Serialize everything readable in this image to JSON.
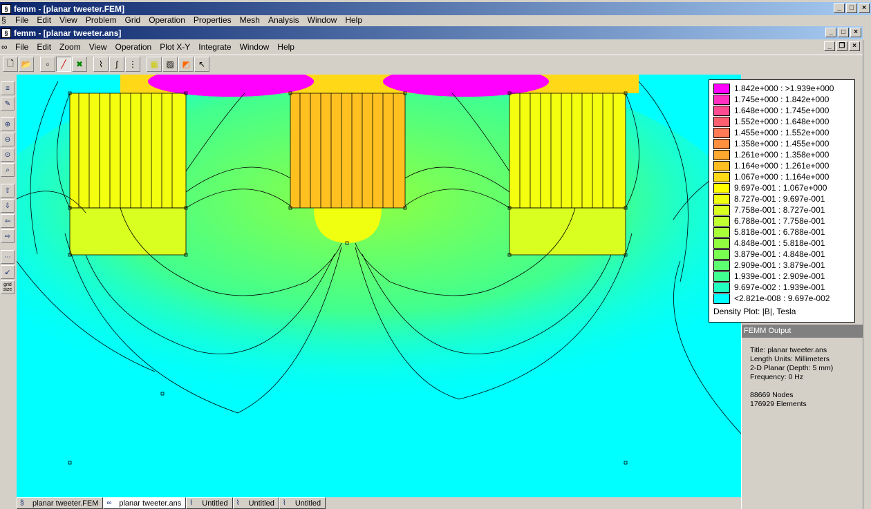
{
  "outer_window": {
    "title": "femm - [planar tweeter.FEM]",
    "menu": [
      "File",
      "Edit",
      "View",
      "Problem",
      "Grid",
      "Operation",
      "Properties",
      "Mesh",
      "Analysis",
      "Window",
      "Help"
    ]
  },
  "inner_window": {
    "title": "femm - [planar tweeter.ans]",
    "menu": [
      "File",
      "Edit",
      "Zoom",
      "View",
      "Operation",
      "Plot X-Y",
      "Integrate",
      "Window",
      "Help"
    ]
  },
  "toolbar": {
    "icons": [
      "new-icon",
      "open-icon",
      "point-mode-icon",
      "contour-mode-icon",
      "area-mode-icon",
      "plot-xy-icon",
      "integrate-icon",
      "block-integral-icon",
      "grid-icon",
      "hatch-icon",
      "density-icon",
      "arrow-icon"
    ]
  },
  "left_toolbar": {
    "icons": [
      "legend-toggle-icon",
      "contour-toggle-icon",
      "zoom-in-icon",
      "zoom-out-icon",
      "zoom-natural-icon",
      "zoom-window-icon",
      "pan-up-icon",
      "pan-down-icon",
      "pan-left-icon",
      "pan-right-icon",
      "grid-show-icon",
      "grid-snap-icon"
    ],
    "grid_size_label": "grid size"
  },
  "legend": {
    "rows": [
      {
        "label": "1.842e+000 : >1.939e+000",
        "color": "#ff00ff"
      },
      {
        "label": "1.745e+000 : 1.842e+000",
        "color": "#ff30c0"
      },
      {
        "label": "1.648e+000 : 1.745e+000",
        "color": "#ff4c90"
      },
      {
        "label": "1.552e+000 : 1.648e+000",
        "color": "#ff6070"
      },
      {
        "label": "1.455e+000 : 1.552e+000",
        "color": "#ff7a55"
      },
      {
        "label": "1.358e+000 : 1.455e+000",
        "color": "#ff9040"
      },
      {
        "label": "1.261e+000 : 1.358e+000",
        "color": "#ffa830"
      },
      {
        "label": "1.164e+000 : 1.261e+000",
        "color": "#ffbe22"
      },
      {
        "label": "1.067e+000 : 1.164e+000",
        "color": "#ffd818"
      },
      {
        "label": "9.697e-001 : 1.067e+000",
        "color": "#ffff00"
      },
      {
        "label": "8.727e-001 : 9.697e-001",
        "color": "#f0ff10"
      },
      {
        "label": "7.758e-001 : 8.727e-001",
        "color": "#d8ff20"
      },
      {
        "label": "6.788e-001 : 7.758e-001",
        "color": "#c0ff30"
      },
      {
        "label": "5.818e-001 : 6.788e-001",
        "color": "#a8ff38"
      },
      {
        "label": "4.848e-001 : 5.818e-001",
        "color": "#90ff40"
      },
      {
        "label": "3.879e-001 : 4.848e-001",
        "color": "#78ff50"
      },
      {
        "label": "2.909e-001 : 3.879e-001",
        "color": "#5cff70"
      },
      {
        "label": "1.939e-001 : 2.909e-001",
        "color": "#40ff90"
      },
      {
        "label": "9.697e-002 : 1.939e-001",
        "color": "#20ffc0"
      },
      {
        "label": "<2.821e-008 : 9.697e-002",
        "color": "#00ffff"
      }
    ],
    "title": "Density Plot: |B|, Tesla"
  },
  "output": {
    "header": "FEMM Output",
    "lines": [
      "Title: planar tweeter.ans",
      "Length Units: Millimeters",
      "2-D Planar (Depth: 5 mm)",
      "Frequency: 0 Hz",
      "",
      "88669 Nodes",
      "176929 Elements"
    ]
  },
  "tabs": [
    {
      "label": "planar tweeter.FEM",
      "active": false
    },
    {
      "label": "planar tweeter.ans",
      "active": true
    },
    {
      "label": "Untitled",
      "active": false
    },
    {
      "label": "Untitled",
      "active": false
    },
    {
      "label": "Untitled",
      "active": false
    }
  ]
}
